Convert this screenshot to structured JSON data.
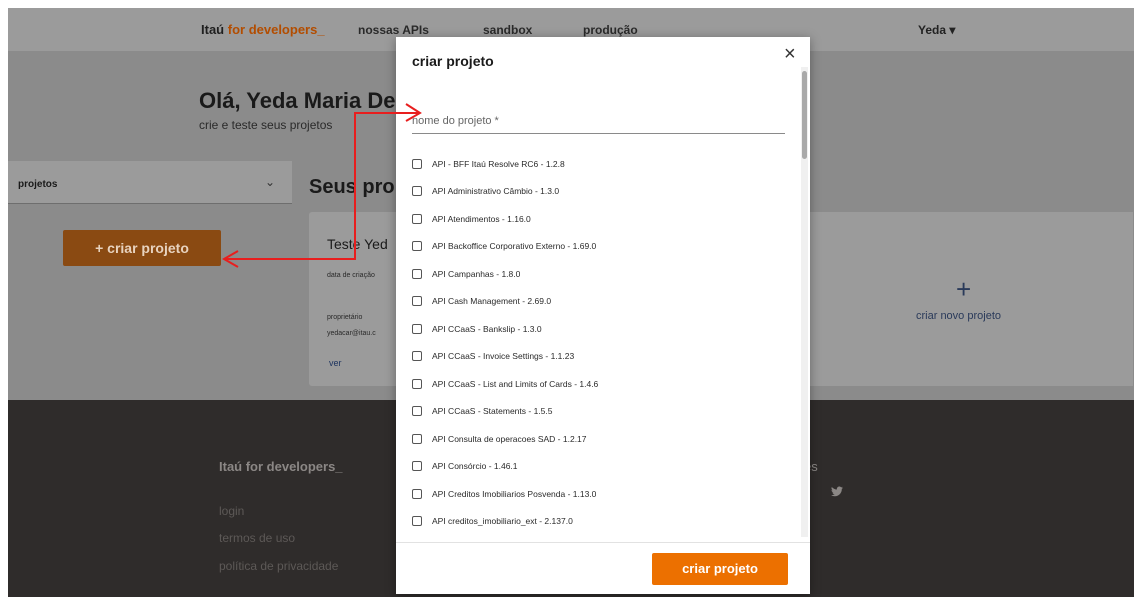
{
  "header": {
    "brand_prefix": "Itaú",
    "brand_accent": "for developers_",
    "nav": [
      "nossas APIs",
      "sandbox",
      "produção"
    ],
    "user": "Yeda ▾"
  },
  "hero": {
    "greeting": "Olá, Yeda Maria De C",
    "subtitle": "crie e teste seus projetos"
  },
  "sidebar": {
    "select_label": "projetos",
    "create_button": "+ criar projeto"
  },
  "projects": {
    "section_title": "Seus pro",
    "card": {
      "title": "Teste Yed",
      "created_label": "data de criação",
      "owner_label": "proprietário",
      "owner_value": "yedacar@itau.c",
      "link": "ver"
    },
    "new_card": {
      "icon": "plus-icon",
      "label": "criar novo projeto"
    }
  },
  "footer": {
    "title": "Itaú for developers_",
    "links": [
      "login",
      "termos de uso",
      "política de privacidade"
    ],
    "social_title": "es",
    "social_icons": [
      "facebook-icon",
      "twitter-icon"
    ]
  },
  "modal": {
    "title": "criar projeto",
    "close_icon": "close-icon",
    "name_placeholder": "nome do projeto *",
    "apis": [
      "API - BFF Itaú Resolve RC6 - 1.2.8",
      "API Administrativo Câmbio - 1.3.0",
      "API Atendimentos - 1.16.0",
      "API Backoffice Corporativo Externo - 1.69.0",
      "API Campanhas - 1.8.0",
      "API Cash Management - 2.69.0",
      "API CCaaS - Bankslip - 1.3.0",
      "API CCaaS - Invoice Settings - 1.1.23",
      "API CCaaS - List and Limits of Cards - 1.4.6",
      "API CCaaS - Statements - 1.5.5",
      "API Consulta de operacoes SAD - 1.2.17",
      "API Consórcio - 1.46.1",
      "API Creditos Imobiliarios Posvenda - 1.13.0",
      "API creditos_imobiliario_ext - 2.137.0"
    ],
    "submit_label": "criar projeto"
  },
  "colors": {
    "accent": "#ec7000",
    "annotation": "#e81e1e"
  }
}
